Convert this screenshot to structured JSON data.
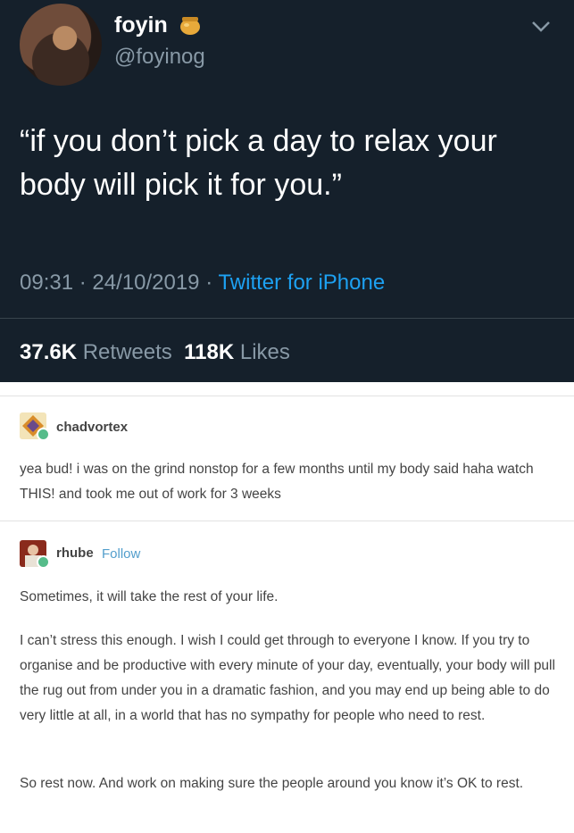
{
  "tweet": {
    "name": "foyin",
    "handle": "@foyinog",
    "text": "“if you don’t pick a day to relax your body will pick it for you.”",
    "time": "09:31",
    "sep1": "·",
    "date": "24/10/2019",
    "sep2": "·",
    "source": "Twitter for iPhone",
    "retweets_count": "37.6K",
    "retweets_label": "Retweets",
    "likes_count": "118K",
    "likes_label": "Likes",
    "colors": {
      "background": "#15202b",
      "muted": "#8899a6",
      "link": "#1da1f2"
    }
  },
  "tumblr": {
    "posts": [
      {
        "username": "chadvortex",
        "paragraphs": [
          "yea bud! i was on the grind nonstop for a few months until my body said haha watch THIS! and took me out of work for 3 weeks"
        ]
      },
      {
        "username": "rhube",
        "follow_label": "Follow",
        "paragraphs": [
          "Sometimes, it will take the rest of your life.",
          "I can’t stress this enough. I wish I could get through to everyone I know. If you try to organise and be productive with every minute of your day, eventually, your body will pull the rug out from under you in a dramatic fashion, and you may end up being able to do very little at all, in a world that has no sympathy for people who need to rest.",
          "So rest now. And work on making sure the people around you know it’s OK to rest."
        ]
      }
    ],
    "colors": {
      "text": "#444444",
      "follow": "#529ecc",
      "badge": "#56bc8a"
    }
  }
}
